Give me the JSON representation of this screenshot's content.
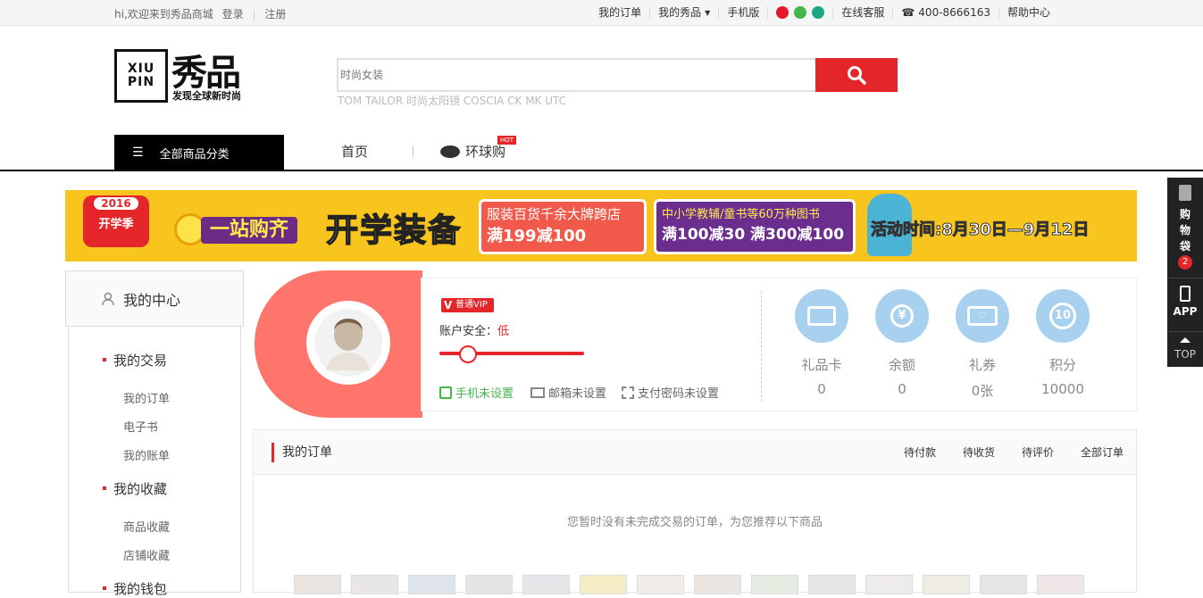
{
  "topbar": {
    "welcome": "hi,欢迎来到秀品商城",
    "login": "登录",
    "register": "注册",
    "my_orders": "我的订单",
    "my_xiupin": "我的秀品",
    "mobile": "手机版",
    "service": "在线客服",
    "phone": "400-8666163",
    "help": "帮助中心"
  },
  "logo": {
    "latin": "XIUPIN",
    "name": "秀品",
    "slogan": "发现全球新时尚"
  },
  "search": {
    "placeholder": "时尚女装",
    "hot": "TOM TAILOR 时尚太阳镜 COSCIA CK MK UTC"
  },
  "nav": {
    "all_categories": "全部商品分类",
    "home": "首页",
    "global": "环球购",
    "hot_badge": "HOT"
  },
  "banner": {
    "year": "2016",
    "season": "开学季",
    "slogan1": "一站购齐",
    "slogan2": "开学装备",
    "promo1_line1": "服装百货千余大牌跨店",
    "promo1_line2": "满199减100",
    "promo2_line1": "中小学教辅/童书等60万种图书",
    "promo2_line2": "满100减30 满300减100",
    "period": "活动时间:8月30日—9月12日"
  },
  "sidebar": {
    "title": "我的中心",
    "sections": [
      {
        "label": "我的交易",
        "links": [
          "我的订单",
          "电子书",
          "我的账单"
        ]
      },
      {
        "label": "我的收藏",
        "links": [
          "商品收藏",
          "店铺收藏"
        ]
      },
      {
        "label": "我的钱包",
        "links": []
      }
    ]
  },
  "profile": {
    "vip": "普通VIP",
    "security_label": "账户安全：",
    "security_level": "低",
    "phone_status": "手机未设置",
    "email_status": "邮箱未设置",
    "paypwd_status": "支付密码未设置"
  },
  "assets": [
    {
      "label": "礼品卡",
      "value": "0"
    },
    {
      "label": "余额",
      "value": "0"
    },
    {
      "label": "礼券",
      "value": "0张"
    },
    {
      "label": "积分",
      "value": "10000"
    }
  ],
  "orders": {
    "title": "我的订单",
    "tabs": [
      "待付款",
      "待收货",
      "待评价",
      "全部订单"
    ],
    "empty": "您暂时没有未完成交易的订单，为您推荐以下商品"
  },
  "rightbar": {
    "cart": "购物袋",
    "cart_count": "2",
    "app": "APP",
    "top": "TOP"
  },
  "colors": {
    "accent": "#e4262b",
    "profile_card": "#ff756b",
    "asset_icon": "#a7d1ef",
    "banner": "#f7c51d"
  }
}
